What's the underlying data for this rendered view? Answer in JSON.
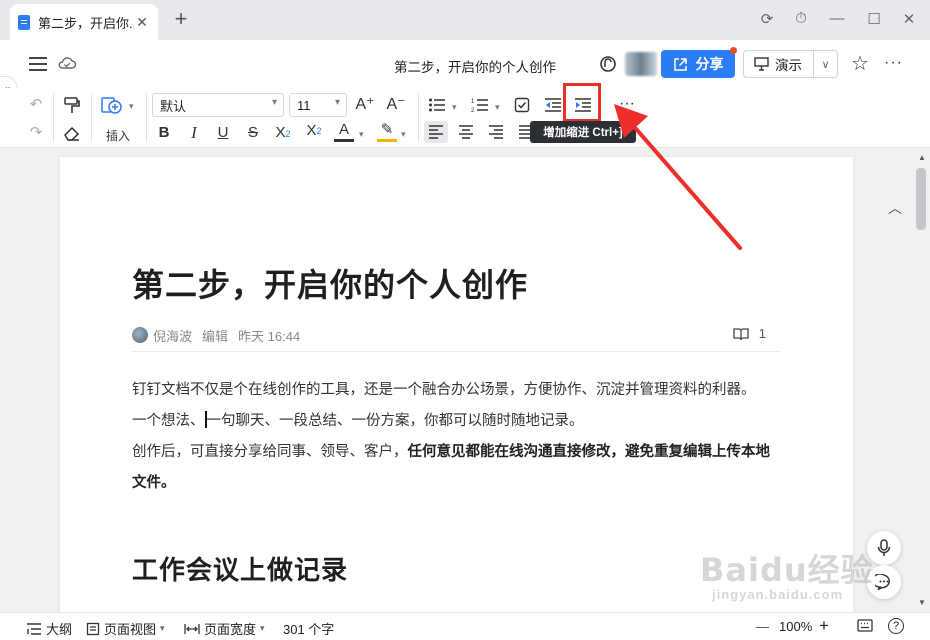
{
  "tab": {
    "title": "第二步，开启你的个人创作",
    "title_display": "第二步，开启你...",
    "close": "✕",
    "add": "+"
  },
  "window": {
    "controls": [
      "⟳",
      "⏱",
      "—",
      "☐",
      "✕"
    ]
  },
  "header": {
    "doc_title": "第二步，开启你的个人创作",
    "share_label": "分享",
    "present_label": "演示",
    "present_dropdown": "∨",
    "star": "☆",
    "more": "···"
  },
  "toolbar": {
    "font_family": "默认",
    "font_size": "11",
    "insert_label": "插入",
    "increase_font": "A⁺",
    "decrease_font": "A⁻",
    "more": "···",
    "tooltip": "增加缩进 Ctrl+]"
  },
  "document": {
    "title": "第二步，开启你的个人创作",
    "author": "倪海波",
    "action": "编辑",
    "time": "昨天 16:44",
    "read_count": "1",
    "para1": "钉钉文档不仅是个在线创作的工具，还是一个融合办公场景，方便协作、沉淀并管理资料的利器。",
    "para2_a": "一个想法、",
    "para2_b": "一句聊天、一段总结、一份方案，你都可以随时随地记录。",
    "para3_a": "创作后，可直接分享给同事、领导、客户，",
    "para3_b": "任何意见都能在线沟通直接修改，避免重复编辑上传本地文件。",
    "heading2": "工作会议上做记录"
  },
  "statusbar": {
    "outline": "大纲",
    "view": "页面视图",
    "width": "页面宽度",
    "word_count": "301 个字",
    "zoom_out": "—",
    "zoom": "100%",
    "zoom_in": "+",
    "help": "?"
  },
  "watermark": {
    "main": "Baidu经验",
    "sub": "jingyan.baidu.com"
  },
  "colors": {
    "accent": "#2b7cf7",
    "highlight": "#e8312b",
    "tooltip_bg": "#2c2f33"
  }
}
